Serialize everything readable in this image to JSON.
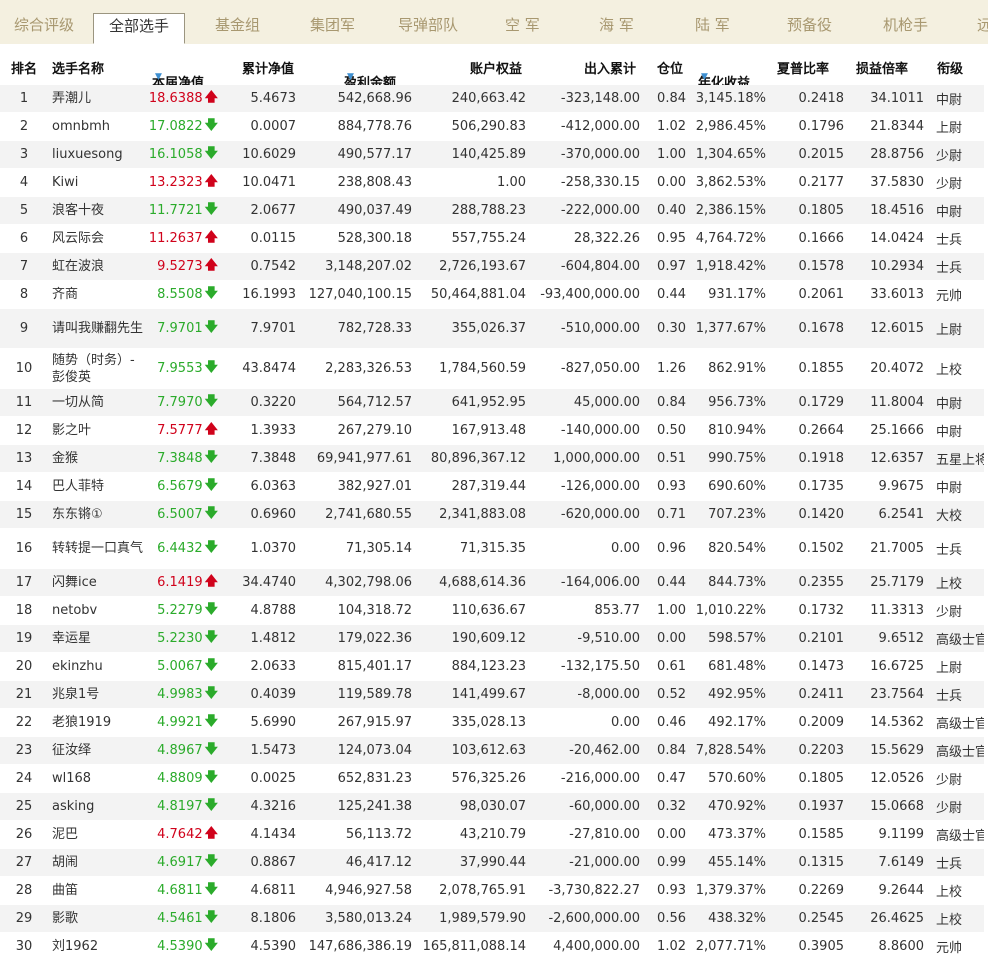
{
  "tabs": [
    {
      "label": "综合评级",
      "active": false
    },
    {
      "label": "全部选手",
      "active": true
    },
    {
      "label": "基金组",
      "active": false
    },
    {
      "label": "集团军",
      "active": false
    },
    {
      "label": "导弹部队",
      "active": false
    },
    {
      "label": "空 军",
      "active": false
    },
    {
      "label": "海 军",
      "active": false
    },
    {
      "label": "陆 军",
      "active": false
    },
    {
      "label": "预备役",
      "active": false
    },
    {
      "label": "机枪手",
      "active": false
    },
    {
      "label": "远",
      "active": false
    }
  ],
  "headers": {
    "rank": "排名",
    "name": "选手名称",
    "nav": "本届净值",
    "cum_nav": "累计净值",
    "profit": "盈利金额",
    "equity": "账户权益",
    "flow": "出入累计",
    "position": "仓位",
    "annual": "年化收益",
    "sharpe": "夏普比率",
    "pl_ratio": "损益倍率",
    "rank_title": "衔级"
  },
  "sort_marker": "▼",
  "arrows": {
    "up": "🡅",
    "down": "🡇"
  },
  "colors": {
    "up": "#d0021b",
    "down": "#2bab2b",
    "sort": "#3d8fd1",
    "tab_inactive": "#a89870",
    "tabbar_bg": "#f4f0e0"
  },
  "rows": [
    {
      "rank": "1",
      "name": "弄潮儿",
      "nav": "18.6388",
      "dir": "up",
      "cum": "5.4673",
      "profit": "542,668.96",
      "equity": "240,663.42",
      "flow": "-323,148.00",
      "pos": "0.84",
      "annual": "3,145.18%",
      "sharpe": "0.2418",
      "pl": "34.1011",
      "title": "中尉"
    },
    {
      "rank": "2",
      "name": "omnbmh",
      "nav": "17.0822",
      "dir": "down",
      "cum": "0.0007",
      "profit": "884,778.76",
      "equity": "506,290.83",
      "flow": "-412,000.00",
      "pos": "1.02",
      "annual": "2,986.45%",
      "sharpe": "0.1796",
      "pl": "21.8344",
      "title": "上尉"
    },
    {
      "rank": "3",
      "name": "liuxuesong",
      "nav": "16.1058",
      "dir": "down",
      "cum": "10.6029",
      "profit": "490,577.17",
      "equity": "140,425.89",
      "flow": "-370,000.00",
      "pos": "1.00",
      "annual": "1,304.65%",
      "sharpe": "0.2015",
      "pl": "28.8756",
      "title": "少尉"
    },
    {
      "rank": "4",
      "name": "Kiwi",
      "nav": "13.2323",
      "dir": "up",
      "cum": "10.0471",
      "profit": "238,808.43",
      "equity": "1.00",
      "flow": "-258,330.15",
      "pos": "0.00",
      "annual": "3,862.53%",
      "sharpe": "0.2177",
      "pl": "37.5830",
      "title": "少尉"
    },
    {
      "rank": "5",
      "name": "浪客十夜",
      "nav": "11.7721",
      "dir": "down",
      "cum": "2.0677",
      "profit": "490,037.49",
      "equity": "288,788.23",
      "flow": "-222,000.00",
      "pos": "0.40",
      "annual": "2,386.15%",
      "sharpe": "0.1805",
      "pl": "18.4516",
      "title": "中尉"
    },
    {
      "rank": "6",
      "name": "风云际会",
      "nav": "11.2637",
      "dir": "up",
      "cum": "0.0115",
      "profit": "528,300.18",
      "equity": "557,755.24",
      "flow": "28,322.26",
      "pos": "0.95",
      "annual": "4,764.72%",
      "sharpe": "0.1666",
      "pl": "14.0424",
      "title": "士兵"
    },
    {
      "rank": "7",
      "name": "虹在波浪",
      "nav": "9.5273",
      "dir": "up",
      "cum": "0.7542",
      "profit": "3,148,207.02",
      "equity": "2,726,193.67",
      "flow": "-604,804.00",
      "pos": "0.97",
      "annual": "1,918.42%",
      "sharpe": "0.1578",
      "pl": "10.2934",
      "title": "士兵"
    },
    {
      "rank": "8",
      "name": "齐商",
      "nav": "8.5508",
      "dir": "down",
      "cum": "16.1993",
      "profit": "127,040,100.15",
      "equity": "50,464,881.04",
      "flow": "-93,400,000.00",
      "pos": "0.44",
      "annual": "931.17%",
      "sharpe": "0.2061",
      "pl": "33.6013",
      "title": "元帅"
    },
    {
      "rank": "9",
      "name": "请叫我赚翻先生",
      "nav": "7.9701",
      "dir": "down",
      "cum": "7.9701",
      "profit": "782,728.33",
      "equity": "355,026.37",
      "flow": "-510,000.00",
      "pos": "0.30",
      "annual": "1,377.67%",
      "sharpe": "0.1678",
      "pl": "12.6015",
      "title": "上尉",
      "tall": true
    },
    {
      "rank": "10",
      "name": "随势（时务）-彭俊英",
      "nav": "7.9553",
      "dir": "down",
      "cum": "43.8474",
      "profit": "2,283,326.53",
      "equity": "1,784,560.59",
      "flow": "-827,050.00",
      "pos": "1.26",
      "annual": "862.91%",
      "sharpe": "0.1855",
      "pl": "20.4072",
      "title": "上校",
      "tall": true
    },
    {
      "rank": "11",
      "name": "一切从简",
      "nav": "7.7970",
      "dir": "down",
      "cum": "0.3220",
      "profit": "564,712.57",
      "equity": "641,952.95",
      "flow": "45,000.00",
      "pos": "0.84",
      "annual": "956.73%",
      "sharpe": "0.1729",
      "pl": "11.8004",
      "title": "中尉"
    },
    {
      "rank": "12",
      "name": "影之叶",
      "nav": "7.5777",
      "dir": "up",
      "cum": "1.3933",
      "profit": "267,279.10",
      "equity": "167,913.48",
      "flow": "-140,000.00",
      "pos": "0.50",
      "annual": "810.94%",
      "sharpe": "0.2664",
      "pl": "25.1666",
      "title": "中尉"
    },
    {
      "rank": "13",
      "name": "金猴",
      "nav": "7.3848",
      "dir": "down",
      "cum": "7.3848",
      "profit": "69,941,977.61",
      "equity": "80,896,367.12",
      "flow": "1,000,000.00",
      "pos": "0.51",
      "annual": "990.75%",
      "sharpe": "0.1918",
      "pl": "12.6357",
      "title": "五星上将"
    },
    {
      "rank": "14",
      "name": "巴人菲特",
      "nav": "6.5679",
      "dir": "down",
      "cum": "6.0363",
      "profit": "382,927.01",
      "equity": "287,319.44",
      "flow": "-126,000.00",
      "pos": "0.93",
      "annual": "690.60%",
      "sharpe": "0.1735",
      "pl": "9.9675",
      "title": "中尉"
    },
    {
      "rank": "15",
      "name": "东东锵①",
      "nav": "6.5007",
      "dir": "down",
      "cum": "0.6960",
      "profit": "2,741,680.55",
      "equity": "2,341,883.08",
      "flow": "-620,000.00",
      "pos": "0.71",
      "annual": "707.23%",
      "sharpe": "0.1420",
      "pl": "6.2541",
      "title": "大校"
    },
    {
      "rank": "16",
      "name": "转转提一口真气",
      "nav": "6.4432",
      "dir": "down",
      "cum": "1.0370",
      "profit": "71,305.14",
      "equity": "71,315.35",
      "flow": "0.00",
      "pos": "0.96",
      "annual": "820.54%",
      "sharpe": "0.1502",
      "pl": "21.7005",
      "title": "士兵",
      "tall": true
    },
    {
      "rank": "17",
      "name": "闪舞ice",
      "nav": "6.1419",
      "dir": "up",
      "cum": "34.4740",
      "profit": "4,302,798.06",
      "equity": "4,688,614.36",
      "flow": "-164,006.00",
      "pos": "0.44",
      "annual": "844.73%",
      "sharpe": "0.2355",
      "pl": "25.7179",
      "title": "上校"
    },
    {
      "rank": "18",
      "name": "netobv",
      "nav": "5.2279",
      "dir": "down",
      "cum": "4.8788",
      "profit": "104,318.72",
      "equity": "110,636.67",
      "flow": "853.77",
      "pos": "1.00",
      "annual": "1,010.22%",
      "sharpe": "0.1732",
      "pl": "11.3313",
      "title": "少尉"
    },
    {
      "rank": "19",
      "name": "幸运星",
      "nav": "5.2230",
      "dir": "down",
      "cum": "1.4812",
      "profit": "179,022.36",
      "equity": "190,609.12",
      "flow": "-9,510.00",
      "pos": "0.00",
      "annual": "598.57%",
      "sharpe": "0.2101",
      "pl": "9.6512",
      "title": "高级士官"
    },
    {
      "rank": "20",
      "name": "ekinzhu",
      "nav": "5.0067",
      "dir": "down",
      "cum": "2.0633",
      "profit": "815,401.17",
      "equity": "884,123.23",
      "flow": "-132,175.50",
      "pos": "0.61",
      "annual": "681.48%",
      "sharpe": "0.1473",
      "pl": "16.6725",
      "title": "上尉"
    },
    {
      "rank": "21",
      "name": "兆泉1号",
      "nav": "4.9983",
      "dir": "down",
      "cum": "0.4039",
      "profit": "119,589.78",
      "equity": "141,499.67",
      "flow": "-8,000.00",
      "pos": "0.52",
      "annual": "492.95%",
      "sharpe": "0.2411",
      "pl": "23.7564",
      "title": "士兵"
    },
    {
      "rank": "22",
      "name": "老狼1919",
      "nav": "4.9921",
      "dir": "down",
      "cum": "5.6990",
      "profit": "267,915.97",
      "equity": "335,028.13",
      "flow": "0.00",
      "pos": "0.46",
      "annual": "492.17%",
      "sharpe": "0.2009",
      "pl": "14.5362",
      "title": "高级士官"
    },
    {
      "rank": "23",
      "name": "征汝绎",
      "nav": "4.8967",
      "dir": "down",
      "cum": "1.5473",
      "profit": "124,073.04",
      "equity": "103,612.63",
      "flow": "-20,462.00",
      "pos": "0.84",
      "annual": "7,828.54%",
      "sharpe": "0.2203",
      "pl": "15.5629",
      "title": "高级士官"
    },
    {
      "rank": "24",
      "name": "wl168",
      "nav": "4.8809",
      "dir": "down",
      "cum": "0.0025",
      "profit": "652,831.23",
      "equity": "576,325.26",
      "flow": "-216,000.00",
      "pos": "0.47",
      "annual": "570.60%",
      "sharpe": "0.1805",
      "pl": "12.0526",
      "title": "少尉"
    },
    {
      "rank": "25",
      "name": "asking",
      "nav": "4.8197",
      "dir": "down",
      "cum": "4.3216",
      "profit": "125,241.38",
      "equity": "98,030.07",
      "flow": "-60,000.00",
      "pos": "0.32",
      "annual": "470.92%",
      "sharpe": "0.1937",
      "pl": "15.0668",
      "title": "少尉"
    },
    {
      "rank": "26",
      "name": "泥巴",
      "nav": "4.7642",
      "dir": "up",
      "cum": "4.1434",
      "profit": "56,113.72",
      "equity": "43,210.79",
      "flow": "-27,810.00",
      "pos": "0.00",
      "annual": "473.37%",
      "sharpe": "0.1585",
      "pl": "9.1199",
      "title": "高级士官"
    },
    {
      "rank": "27",
      "name": "胡闹",
      "nav": "4.6917",
      "dir": "down",
      "cum": "0.8867",
      "profit": "46,417.12",
      "equity": "37,990.44",
      "flow": "-21,000.00",
      "pos": "0.99",
      "annual": "455.14%",
      "sharpe": "0.1315",
      "pl": "7.6149",
      "title": "士兵"
    },
    {
      "rank": "28",
      "name": "曲笛",
      "nav": "4.6811",
      "dir": "down",
      "cum": "4.6811",
      "profit": "4,946,927.58",
      "equity": "2,078,765.91",
      "flow": "-3,730,822.27",
      "pos": "0.93",
      "annual": "1,379.37%",
      "sharpe": "0.2269",
      "pl": "9.2644",
      "title": "上校"
    },
    {
      "rank": "29",
      "name": "影歌",
      "nav": "4.5461",
      "dir": "down",
      "cum": "8.1806",
      "profit": "3,580,013.24",
      "equity": "1,989,579.90",
      "flow": "-2,600,000.00",
      "pos": "0.56",
      "annual": "438.32%",
      "sharpe": "0.2545",
      "pl": "26.4625",
      "title": "上校"
    },
    {
      "rank": "30",
      "name": "刘1962",
      "nav": "4.5390",
      "dir": "down",
      "cum": "4.5390",
      "profit": "147,686,386.19",
      "equity": "165,811,088.14",
      "flow": "4,400,000.00",
      "pos": "1.02",
      "annual": "2,077.71%",
      "sharpe": "0.3905",
      "pl": "8.8600",
      "title": "元帅"
    }
  ]
}
